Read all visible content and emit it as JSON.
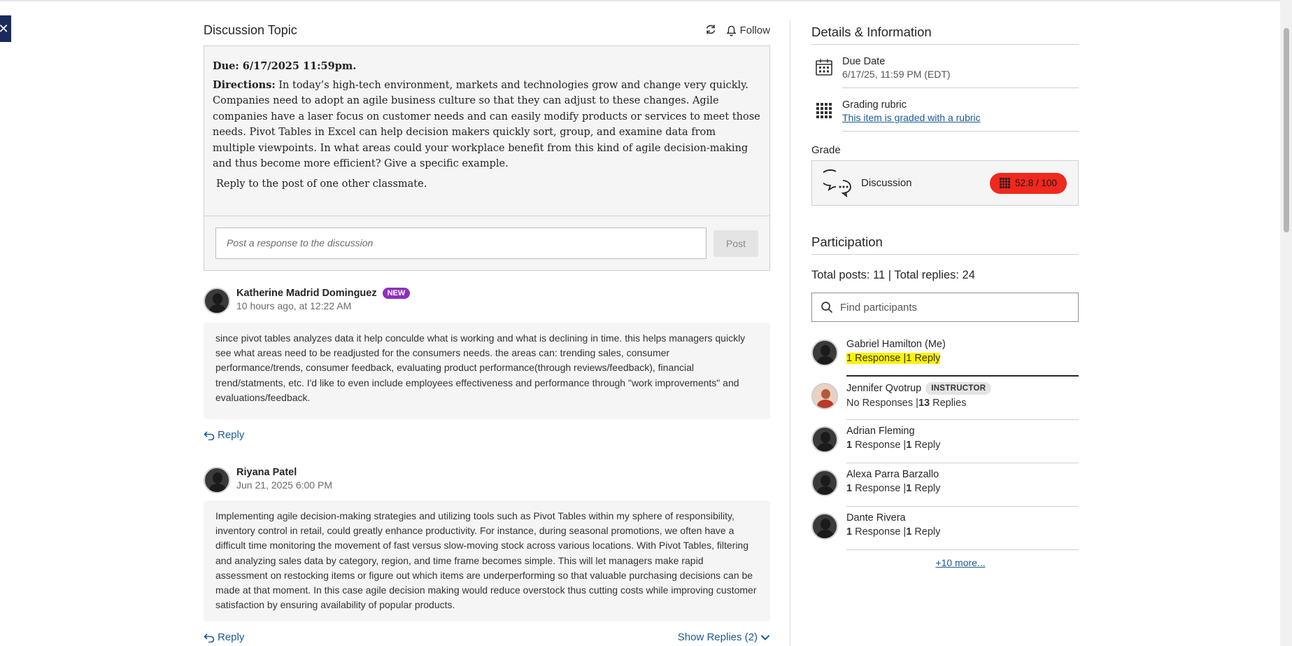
{
  "left": {
    "header": {
      "title": "Discussion Topic",
      "follow_label": "Follow"
    },
    "topic": {
      "due": "Due: 6/17/2025 11:59pm.",
      "directions_label": "Directions:",
      "directions_text": " In today’s high-tech environment, markets and technologies grow and change very quickly. Companies need to adopt an agile business culture so that they can adjust to these changes. Agile companies have a laser focus on customer needs and can easily modify products or services to meet those needs. Pivot Tables in Excel can help decision makers quickly sort, group, and examine data from multiple viewpoints. In what areas could your workplace benefit from this kind of agile decision-making and thus become more efficient? Give a specific example.",
      "reply_note": "Reply to the post of one other classmate."
    },
    "composer": {
      "placeholder": "Post a response to the discussion",
      "post_label": "Post"
    },
    "posts": [
      {
        "author": "Katherine Madrid Dominguez",
        "badge": "NEW",
        "time": "10 hours ago, at 12:22 AM",
        "content": "since pivot tables analyzes data it help conculde what is working and what is declining in time. this helps managers quickly see what areas need to be readjusted for the consumers needs. the areas can: trending sales, consumer performance/trends, consumer feedback, evaluating product performance(through reviews/feedback), financial trend/statments, etc. I'd like to even include employees effectiveness and performance through \"work improvements\" and evaluations/feedback.",
        "reply_label": "Reply"
      },
      {
        "author": "Riyana Patel",
        "time": "Jun 21, 2025 6:00 PM",
        "content": "Implementing agile decision-making strategies and utilizing tools such as Pivot Tables within my sphere of responsibility, inventory control in retail, could greatly enhance productivity. For instance, during seasonal promotions, we often have a difficult time monitoring the movement of fast versus slow-moving stock across various locations. With Pivot Tables, filtering and analyzing sales data by category, region, and time frame becomes simple. This will let managers make rapid assessment on restocking items or figure out which items are underperforming so that valuable purchasing decisions can be made at that moment. In this case agile decision making would reduce overstock thus cutting costs while improving customer satisfaction by ensuring availability of popular products.",
        "reply_label": "Reply",
        "show_replies": "Show Replies (2)"
      }
    ]
  },
  "right": {
    "details_title": "Details & Information",
    "due": {
      "label": "Due Date",
      "value": "6/17/25, 11:59 PM (EDT)"
    },
    "rubric": {
      "label": "Grading rubric",
      "link": "This item is graded with a rubric"
    },
    "grade": {
      "label": "Grade",
      "name": "Discussion",
      "score": "52.8 / 100"
    },
    "participation_title": "Participation",
    "totals": "Total posts: 11 | Total replies: 24",
    "search_placeholder": "Find participants",
    "participants": [
      {
        "name": "Gabriel Hamilton (Me)",
        "resp_count": "1",
        "resp_label": " Response ",
        "reply_count": "1",
        "reply_label": " Reply"
      },
      {
        "name": "Jennifer Qvotrup",
        "badge": "INSTRUCTOR",
        "resp_count": "No",
        "resp_label": " Responses ",
        "reply_count": "13",
        "reply_label": " Replies"
      },
      {
        "name": "Adrian Fleming",
        "resp_count": "1",
        "resp_label": " Response ",
        "reply_count": "1",
        "reply_label": " Reply"
      },
      {
        "name": "Alexa Parra Barzallo",
        "resp_count": "1",
        "resp_label": " Response ",
        "reply_count": "1",
        "reply_label": " Reply"
      },
      {
        "name": "Dante Rivera",
        "resp_count": "1",
        "resp_label": " Response ",
        "reply_count": "1",
        "reply_label": " Reply"
      }
    ],
    "more_link": "+10 more..."
  },
  "colors": {
    "accent_link": "#1a5a96",
    "grade_pill": "#f0281e",
    "new_badge": "#8f2fbf",
    "highlight": "#fff200",
    "close_button": "#1b2a5c"
  },
  "icons": {
    "close": "close-icon",
    "refresh": "refresh-icon",
    "bell": "bell-icon",
    "calendar": "calendar-icon",
    "rubric": "rubric-grid-icon",
    "discussion": "discussion-bubbles-icon",
    "search": "search-icon",
    "reply": "reply-arrow-icon",
    "chevron": "chevron-down-icon"
  }
}
